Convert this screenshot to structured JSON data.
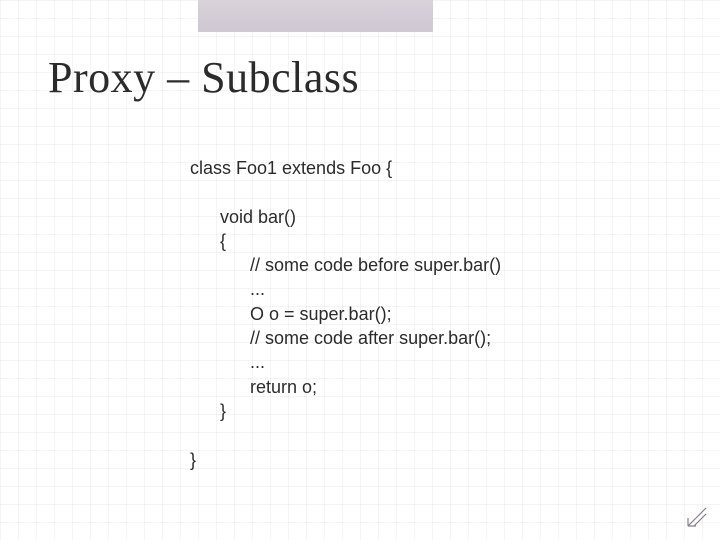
{
  "title": "Proxy – Subclass",
  "code": {
    "l0": "class Foo1 extends Foo {",
    "l1": "void bar()",
    "l2": "{",
    "l3": "// some code before super.bar()",
    "l4": "...",
    "l5": "O o = super.bar();",
    "l6": "// some code after super.bar();",
    "l7": "...",
    "l8": "return o;",
    "l9": "}",
    "l10": "}"
  }
}
